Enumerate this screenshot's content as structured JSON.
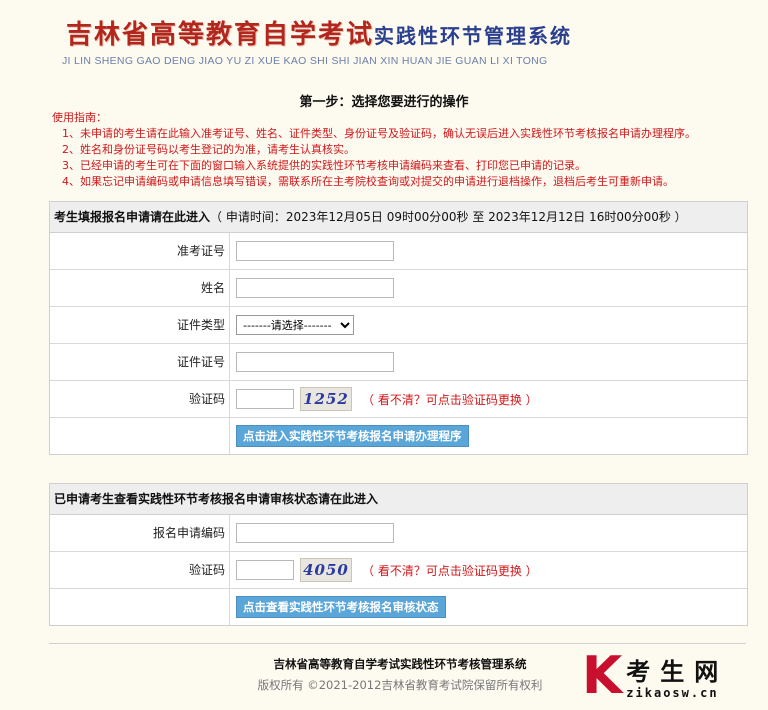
{
  "banner": {
    "title_part1": "吉林省高等教育自学考试",
    "title_part2": "实践性环节管理系统",
    "pinyin": "JI LIN SHENG GAO DENG JIAO YU ZI XUE KAO SHI  SHI JIAN XIN HUAN JIE GUAN LI XI TONG"
  },
  "step_title": "第一步：选择您要进行的操作",
  "guide": {
    "heading": "使用指南：",
    "items": [
      "1、未申请的考生请在此输入准考证号、姓名、证件类型、身份证号及验证码，确认无误后进入实践性环节考核报名申请办理程序。",
      "2、姓名和身份证号码以考生登记的为准，请考生认真核实。",
      "3、已经申请的考生可在下面的窗口输入系统提供的实践性环节考核申请编码来查看、打印您已申请的记录。",
      "4、如果忘记申请编码或申请信息填写错误，需联系所在主考院校查询或对提交的申请进行退档操作，退档后考生可重新申请。"
    ]
  },
  "apply_panel": {
    "header": "考生填报报名申请请在此进入",
    "time_info": "（ 申请时间：2023年12月05日 09时00分00秒 至 2023年12月12日 16时00分00秒 ）",
    "exam_no_label": "准考证号",
    "name_label": "姓名",
    "id_type_label": "证件类型",
    "id_type_selected": "-------请选择-------",
    "id_no_label": "证件证号",
    "captcha_label": "验证码",
    "captcha_text": "1252",
    "captcha_hint": "（ 看不清？可点击验证码更换 ）",
    "submit_label": "点击进入实践性环节考核报名申请办理程序"
  },
  "query_panel": {
    "header": "已申请考生查看实践性环节考核报名申请审核状态请在此进入",
    "code_label": "报名申请编码",
    "captcha_label": "验证码",
    "captcha_text": "4050",
    "captcha_hint": "（ 看不清？可点击验证码更换 ）",
    "submit_label": "点击查看实践性环节考核报名审核状态"
  },
  "footer": {
    "system_name": "吉林省高等教育自学考试实践性环节考核管理系统",
    "copyright": "版权所有 ©2021-2012吉林省教育考试院保留所有权利"
  },
  "watermark": {
    "letter": "K",
    "cn": "考生网",
    "domain": "zikaosw.cn"
  }
}
